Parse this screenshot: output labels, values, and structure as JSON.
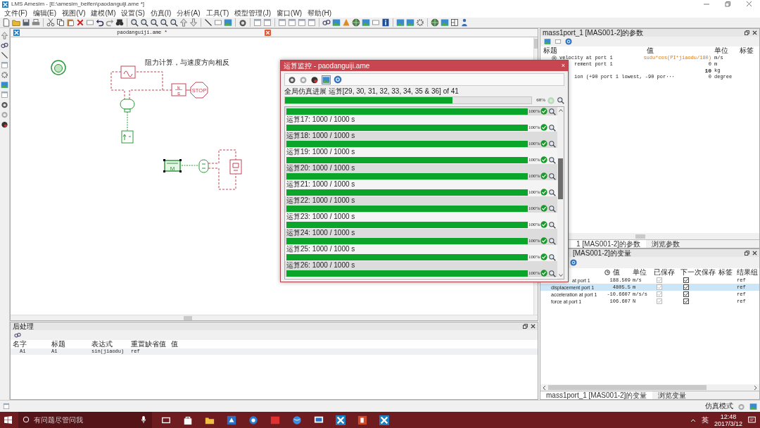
{
  "window": {
    "title": "LMS Amesim - [E:\\amesim_beifen\\paodanguiji.ame *]"
  },
  "menu": [
    "文件(F)",
    "编辑(E)",
    "视图(V)",
    "建模(M)",
    "设置(S)",
    "仿真(I)",
    "分析(A)",
    "工具(T)",
    "模型管理(J)",
    "窗口(W)",
    "帮助(H)"
  ],
  "canvas": {
    "title": "paodanguiji.ame *",
    "note": "阻力计算，与速度方向相反",
    "integrator_top": "k",
    "integrator_bottom": "s",
    "stop_label": "STOP",
    "mass_label": "M"
  },
  "monitor": {
    "title": "运算监控 - paodanguiji.ame",
    "close": "×",
    "overall_label": "全局仿真进展 运算[29, 30, 31, 32, 33, 34, 35 & 36] of 41",
    "overall": {
      "level": 0.68,
      "percent": "68%",
      "done": false
    },
    "runs": [
      {
        "level": 1,
        "percent": "100%",
        "done": true
      },
      {
        "label": "运算17: 1000 / 1000 s",
        "level": 1,
        "percent": "100%",
        "done": true
      },
      {
        "label": "运算18: 1000 / 1000 s",
        "level": 1,
        "percent": "100%",
        "done": true
      },
      {
        "label": "运算19: 1000 / 1000 s",
        "level": 1,
        "percent": "100%",
        "done": true
      },
      {
        "label": "运算20: 1000 / 1000 s",
        "level": 1,
        "percent": "100%",
        "done": true
      },
      {
        "label": "运算21: 1000 / 1000 s",
        "level": 1,
        "percent": "100%",
        "done": true
      },
      {
        "label": "运算22: 1000 / 1000 s",
        "level": 1,
        "percent": "100%",
        "done": true
      },
      {
        "label": "运算23: 1000 / 1000 s",
        "level": 1,
        "percent": "100%",
        "done": true
      },
      {
        "label": "运算24: 1000 / 1000 s",
        "level": 1,
        "percent": "100%",
        "done": true
      },
      {
        "label": "运算25: 1000 / 1000 s",
        "level": 1,
        "percent": "100%",
        "done": true
      },
      {
        "label": "运算26: 1000 / 1000 s",
        "level": 1,
        "percent": "100%",
        "done": true
      }
    ]
  },
  "parameters": {
    "title": "mass1port_1 [MAS001-2]的参数",
    "columns": [
      "标题",
      "值",
      "单位",
      "标签"
    ],
    "rows": [
      {
        "title": "velocity at port 1",
        "value": "sudu*cos(PI*jiaodu/180)",
        "unit": "m/s",
        "kind": "expression"
      },
      {
        "title": "rement port 1",
        "value": "0",
        "unit": "m",
        "kind": "default"
      },
      {
        "value": "10",
        "unit": "kg",
        "kind": "modified"
      },
      {
        "title": "ion (+90 port 1 lowest, -90 por···",
        "value": "0",
        "unit": "degree",
        "kind": "default"
      }
    ],
    "tabs": [
      {
        "label": "1 [MAS001-2]的参数",
        "selected": true
      },
      {
        "label": "浏览参数",
        "selected": false
      }
    ]
  },
  "variables": {
    "title": "[MAS001-2]的变量",
    "columns": [
      "值",
      "单位",
      "已保存",
      "下一次保存",
      "标签",
      "结果组"
    ],
    "rows": [
      {
        "title": "at port 1",
        "value": "188.509",
        "unit": "m/s",
        "saved": true,
        "next_save": true,
        "result_group": "ref",
        "selected": false
      },
      {
        "title": "displacement port 1",
        "value": "4805.5",
        "unit": "m",
        "saved": true,
        "next_save": true,
        "result_group": "ref",
        "selected": true
      },
      {
        "title": "acceleration at port 1",
        "value": "-10.6607",
        "unit": "m/s/s",
        "saved": true,
        "next_save": true,
        "result_group": "ref",
        "selected": false
      },
      {
        "title": "force at port 1",
        "value": "106.607",
        "unit": "N",
        "saved": true,
        "next_save": true,
        "result_group": "ref",
        "selected": false
      }
    ],
    "tabs": [
      {
        "label": "mass1port_1 [MAS001-2]的变量",
        "selected": true
      },
      {
        "label": "浏览变量",
        "selected": false
      }
    ]
  },
  "post": {
    "title": "后处理",
    "columns": [
      "名字",
      "标题",
      "表达式",
      "重置缺省值",
      "值"
    ],
    "rows": [
      {
        "name": "A1",
        "title": "A1",
        "expression": "sin(jiaodu)",
        "reset": "ref"
      }
    ]
  },
  "status": {
    "mode": "仿真模式"
  },
  "taskbar": {
    "search_placeholder": "有问题尽管问我",
    "ime": "英",
    "time": "12:48",
    "date": "2017/3/12"
  }
}
